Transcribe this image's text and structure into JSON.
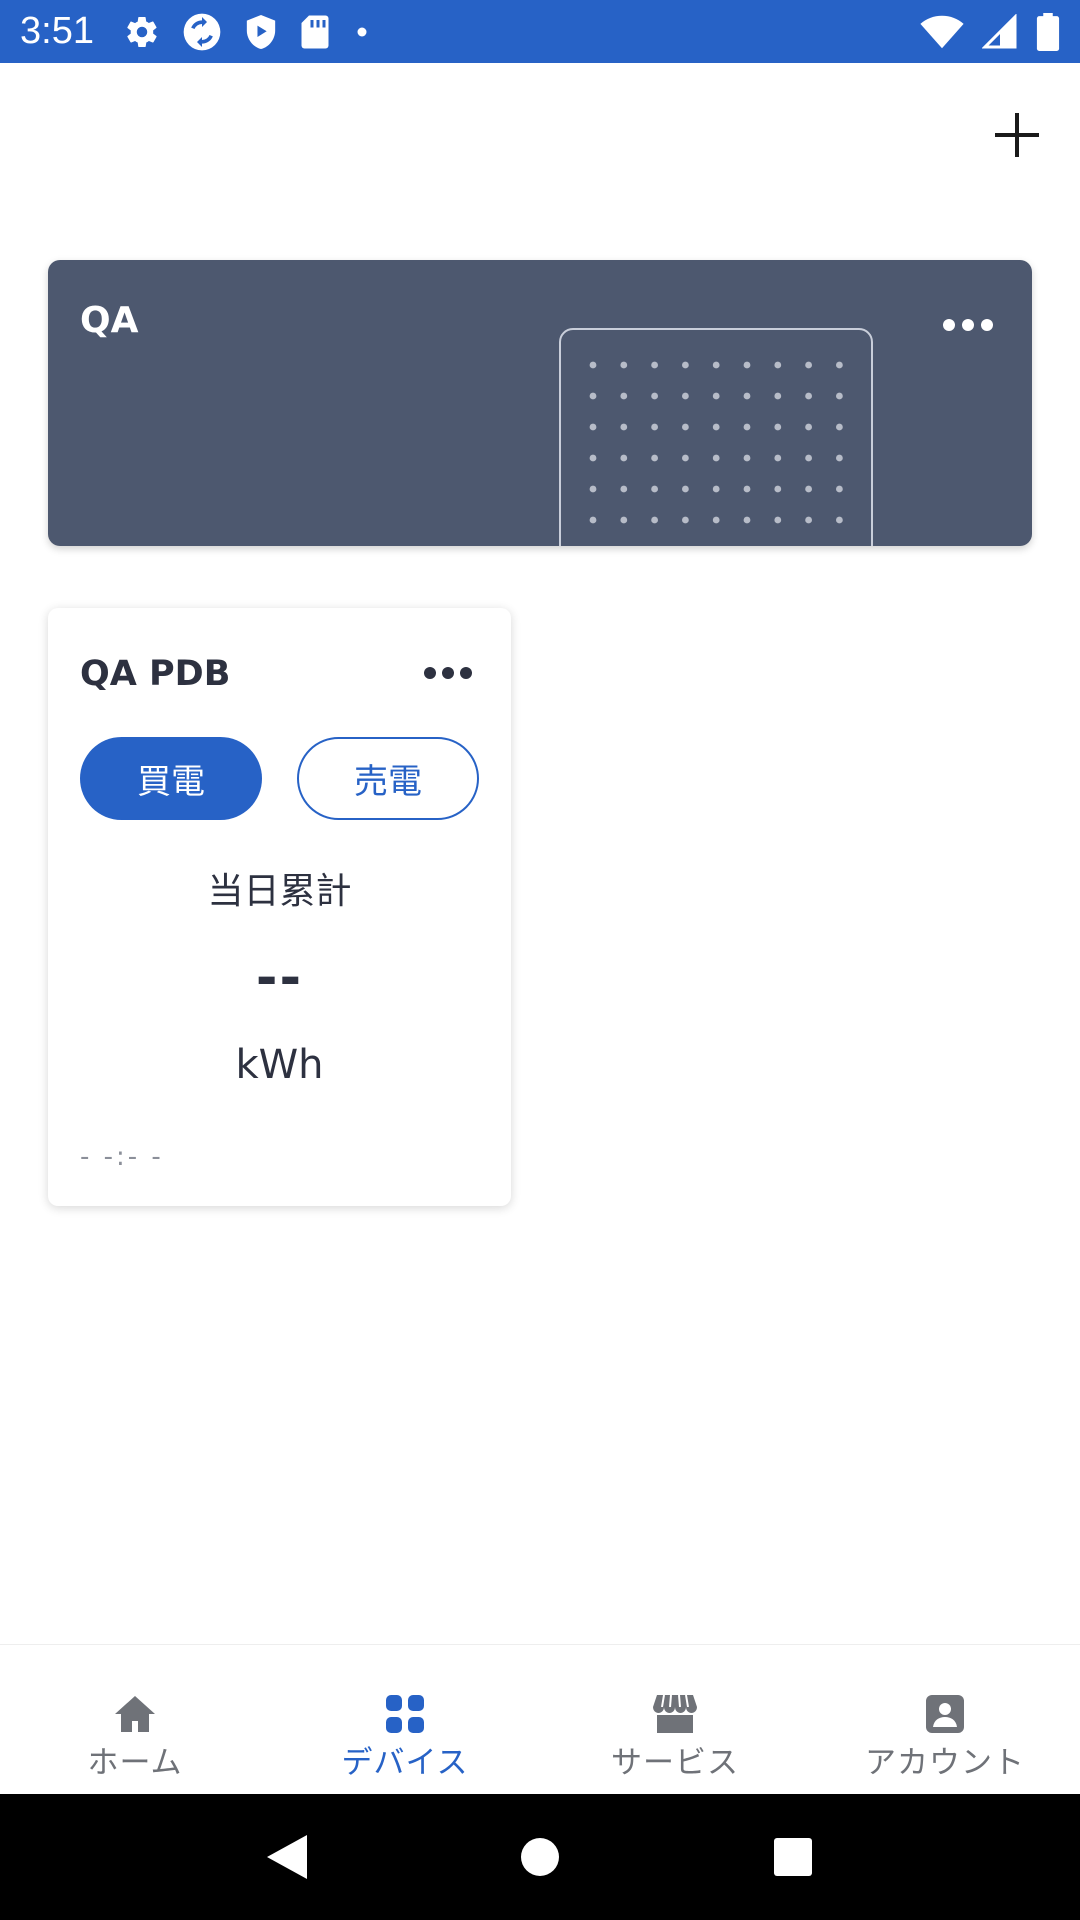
{
  "status_bar": {
    "time": "3:51",
    "icons_left": [
      "settings-icon",
      "sync-icon",
      "shield-play-icon",
      "sd-card-icon",
      "dot-icon"
    ],
    "icons_right": [
      "wifi-icon",
      "signal-icon",
      "battery-icon"
    ],
    "background": "#2762c6"
  },
  "header": {
    "add_icon": "plus-icon"
  },
  "group_card": {
    "title": "QA",
    "more_icon": "more-horizontal-icon",
    "background": "#4d586f"
  },
  "device_card": {
    "title": "QA PDB",
    "more_icon": "more-horizontal-icon",
    "toggle": {
      "buy_label": "買電",
      "sell_label": "売電",
      "selected": "buy"
    },
    "daily_label": "当日累計",
    "value": "--",
    "unit": "kWh",
    "updated_time": "- -:- -"
  },
  "bottom_nav": {
    "items": [
      {
        "label": "ホーム",
        "icon": "home-icon",
        "active": false
      },
      {
        "label": "デバイス",
        "icon": "devices-grid-icon",
        "active": true
      },
      {
        "label": "サービス",
        "icon": "store-icon",
        "active": false
      },
      {
        "label": "アカウント",
        "icon": "account-icon",
        "active": false
      }
    ],
    "accent": "#2762c6"
  },
  "system_nav": {
    "buttons": [
      "back-icon",
      "home-circle-icon",
      "recents-icon"
    ]
  }
}
